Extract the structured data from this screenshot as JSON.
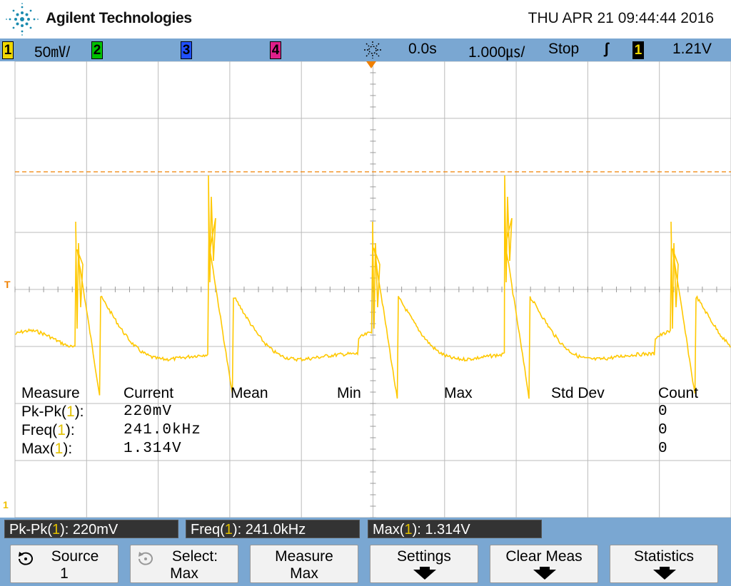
{
  "header": {
    "brand": "Agilent Technologies",
    "datetime": "THU APR 21 09:44:44 2016"
  },
  "status": {
    "ch1_num": "1",
    "ch1_scale": "50㎷/",
    "ch2_num": "2",
    "ch3_num": "3",
    "ch4_num": "4",
    "delay": "0.0s",
    "timebase": "1.000㎲/",
    "run_state": "Stop",
    "trigger_edge": "ʃ",
    "trigger_src": "1",
    "trigger_level": "1.21V"
  },
  "markers": {
    "trigger": "T",
    "ground": "1"
  },
  "measurements": {
    "headers": [
      "Measure",
      "Current",
      "Mean",
      "Min",
      "Max",
      "Std Dev",
      "Count"
    ],
    "rows": [
      {
        "name": "Pk-Pk(",
        "ch": "1",
        "close": "):",
        "current": "220mV",
        "count": "0"
      },
      {
        "name": "Freq(",
        "ch": "1",
        "close": "):",
        "current": "241.0kHz",
        "count": "0"
      },
      {
        "name": "Max(",
        "ch": "1",
        "close": "):",
        "current": "1.314V",
        "count": "0"
      }
    ]
  },
  "measbar": [
    {
      "pre": "Pk-Pk(",
      "ch": "1",
      "post": "): 220mV"
    },
    {
      "pre": "Freq(",
      "ch": "1",
      "post": "): 241.0kHz"
    },
    {
      "pre": "Max(",
      "ch": "1",
      "post": "): 1.314V"
    }
  ],
  "softkeys": [
    {
      "line1": "Source",
      "line2": "1",
      "icon": "rotate-knob-icon"
    },
    {
      "line1": "Select:",
      "line2": "Max",
      "icon": "rotate-knob-icon"
    },
    {
      "line1": "Measure",
      "line2": "Max"
    },
    {
      "line1": "Settings",
      "line2": "",
      "icon": "down-arrow-icon"
    },
    {
      "line1": "Clear Meas",
      "line2": "",
      "icon": "down-arrow-icon"
    },
    {
      "line1": "Statistics",
      "line2": "",
      "icon": "down-arrow-icon"
    }
  ],
  "colors": {
    "trace": "#ffc800",
    "ch1": "#f0d800",
    "ch2": "#00c000",
    "ch3": "#2050ff",
    "ch4": "#e0208a",
    "trigger_marker": "#f08000",
    "bar": "#7aa7d2"
  }
}
